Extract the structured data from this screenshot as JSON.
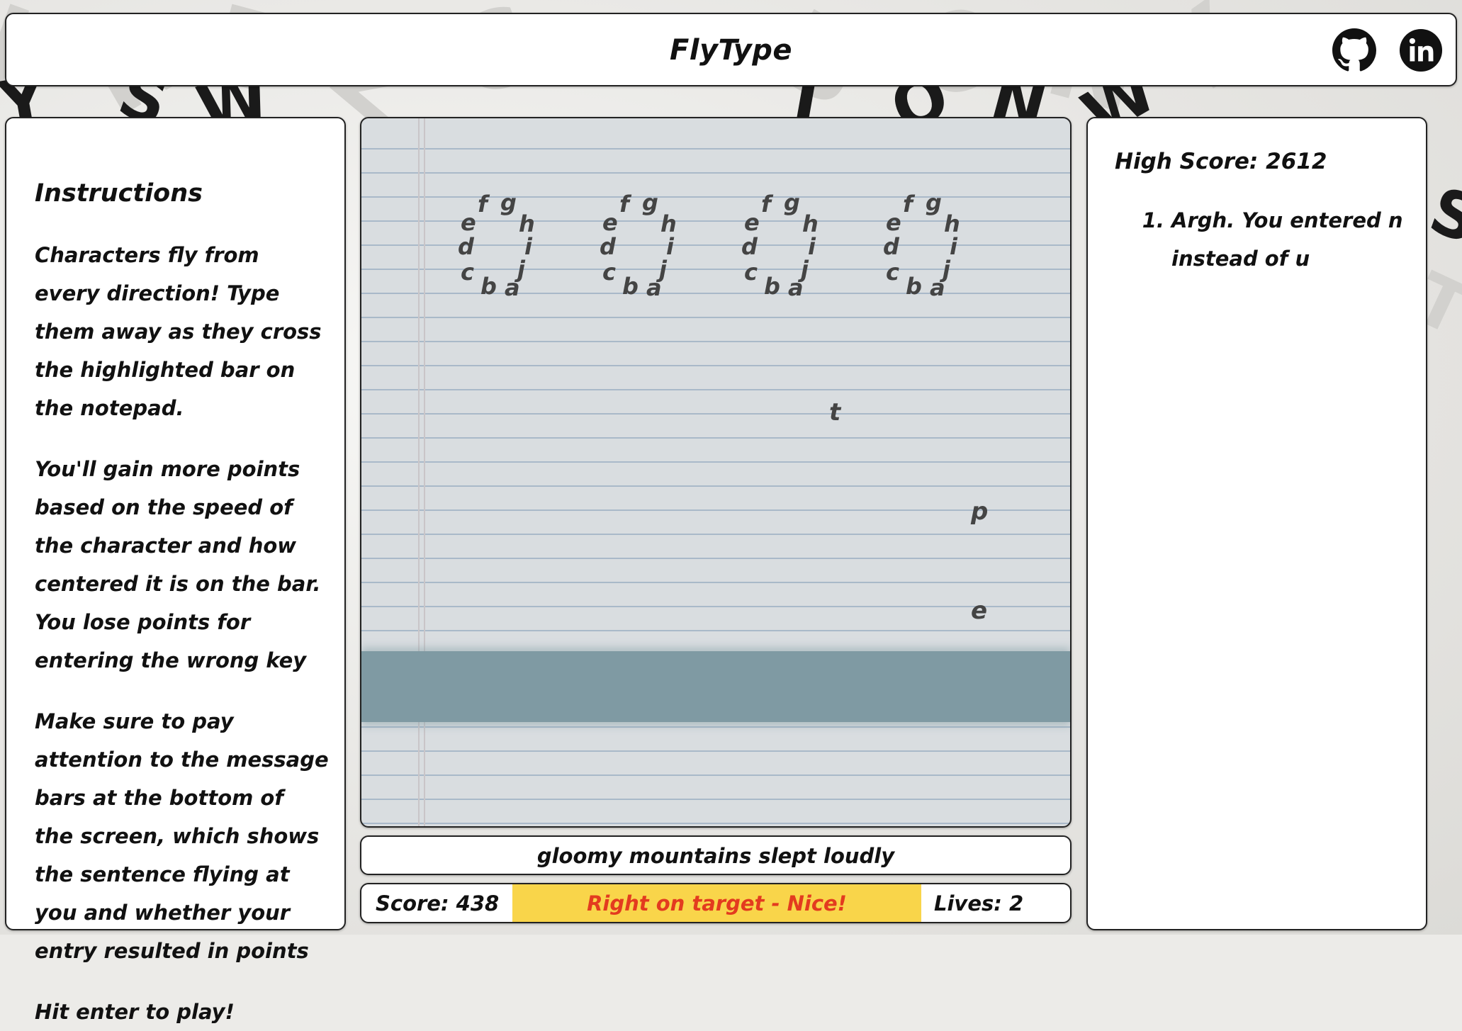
{
  "header": {
    "title": "FlyType",
    "github_icon": "github-icon",
    "linkedin_icon": "linkedin-icon"
  },
  "instructions": {
    "title": "Instructions",
    "paragraphs": [
      "Characters fly from every direction! Type them away as they cross the highlighted bar on the notepad.",
      "You'll gain more points based on the speed of the character and how centered it is on the bar. You lose points for entering the wrong key",
      "Make sure to pay attention to the message bars at the bottom of the screen, which shows the sentence flying at you and whether your entry resulted in points",
      "Hit enter to play!"
    ]
  },
  "game": {
    "ring_letters": [
      "a",
      "b",
      "c",
      "d",
      "e",
      "f",
      "g",
      "h",
      "i",
      "j"
    ],
    "ring_count": 4,
    "flying_chars": [
      "t",
      "p",
      "e"
    ]
  },
  "sentence": "gloomy mountains slept loudly",
  "status": {
    "score_label": "Score: 438",
    "feedback": "Right on target - Nice!",
    "lives_label": "Lives: 2"
  },
  "right": {
    "high_score": "High Score: 2612",
    "messages": [
      "Argh. You entered n instead of u"
    ]
  },
  "colors": {
    "feedback_bg": "#f9d54a",
    "feedback_text": "#e33b1f",
    "target_bar": "#7f9aa3"
  }
}
